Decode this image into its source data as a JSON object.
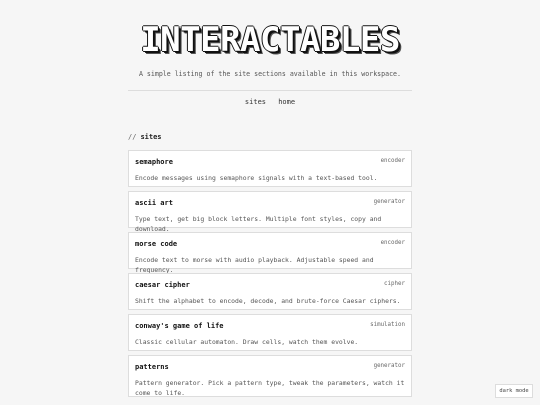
{
  "header": {
    "logo_text": "INTERACTABLES",
    "tagline": "A simple listing of the site sections available in this workspace."
  },
  "nav": {
    "items": [
      "sites",
      "home"
    ]
  },
  "section": {
    "prefix": "//",
    "title": "sites"
  },
  "cards": [
    {
      "name": "semaphore",
      "tag": "encoder",
      "desc": "Encode messages using semaphore signals with a text-based tool."
    },
    {
      "name": "ascii art",
      "tag": "generator",
      "desc": "Type text, get big block letters. Multiple font styles, copy and download."
    },
    {
      "name": "morse code",
      "tag": "encoder",
      "desc": "Encode text to morse with audio playback. Adjustable speed and frequency."
    },
    {
      "name": "caesar cipher",
      "tag": "cipher",
      "desc": "Shift the alphabet to encode, decode, and brute-force Caesar ciphers."
    },
    {
      "name": "conway's game of life",
      "tag": "simulation",
      "desc": "Classic cellular automaton. Draw cells, watch them evolve."
    },
    {
      "name": "patterns",
      "tag": "generator",
      "desc": "Pattern generator. Pick a pattern type, tweak the parameters, watch it come to life."
    }
  ],
  "dark_mode_label": "dark mode"
}
